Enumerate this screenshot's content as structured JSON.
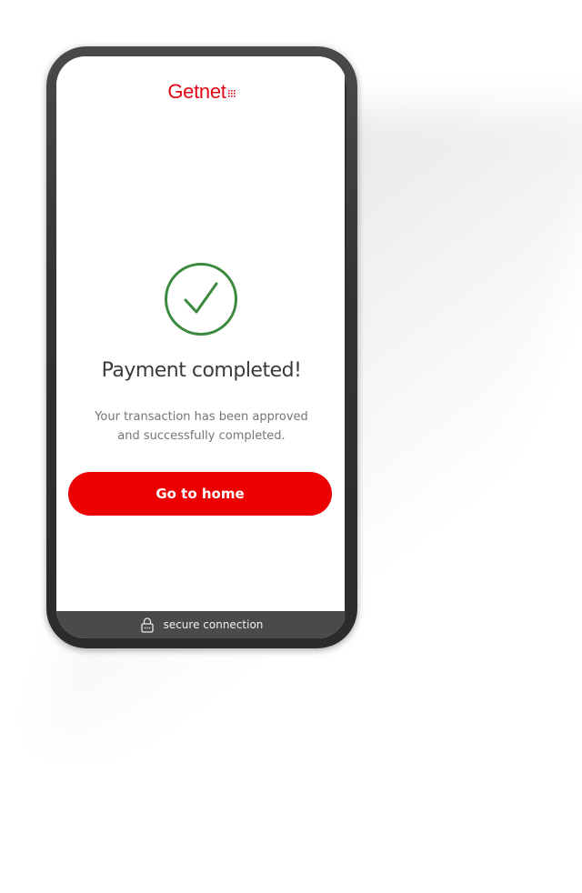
{
  "brand": {
    "name": "Getnet",
    "color": "#e30613"
  },
  "status": {
    "icon": "check-circle-icon",
    "color": "#3c8a3e",
    "title": "Payment completed!",
    "message_line1": "Your transaction has been approved",
    "message_line2": "and successfully completed."
  },
  "actions": {
    "home_label": "Go to home",
    "home_color": "#ec0000"
  },
  "footer": {
    "icon": "lock-icon",
    "label": "secure connection"
  }
}
